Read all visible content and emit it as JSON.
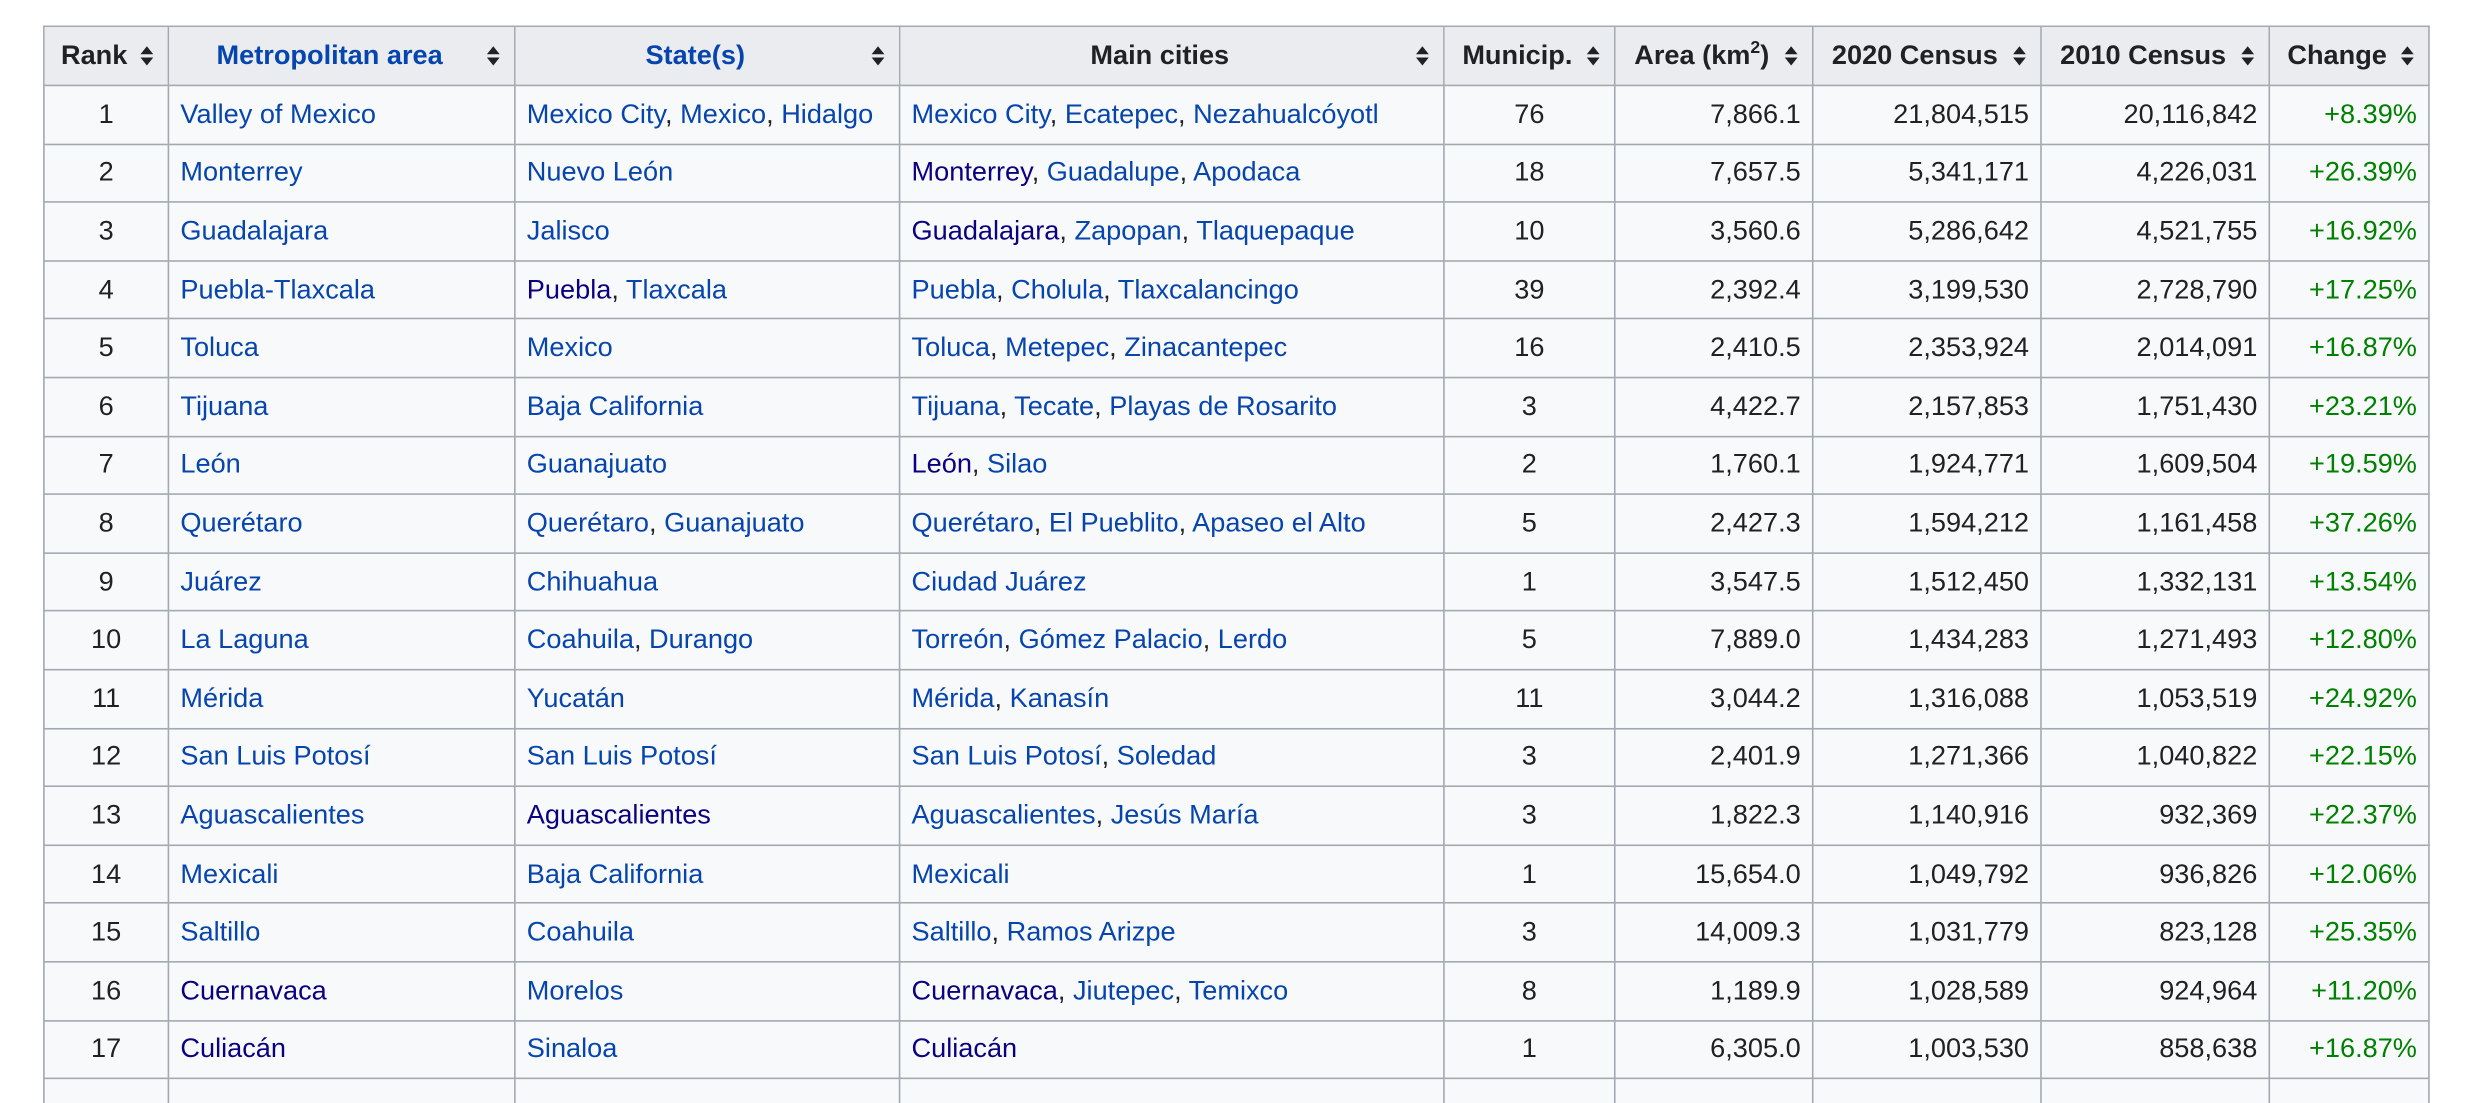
{
  "colors": {
    "link": "#0645ad",
    "link_visited": "#0b0080",
    "positive_change": "#008000",
    "header_bg": "#eaecf0",
    "cell_bg": "#f8f9fa",
    "border": "#a2a9b1"
  },
  "icons": {
    "sort": "sort-updown-icon"
  },
  "table": {
    "headers": {
      "rank": "Rank",
      "metro": "Metropolitan area",
      "states": "State(s)",
      "cities": "Main cities",
      "municip": "Municip.",
      "area": "Area (km",
      "area_sup": "2",
      "area_end": ")",
      "census2020": "2020 Census",
      "census2010": "2010 Census",
      "change": "Change"
    },
    "rows": [
      {
        "rank": "1",
        "metro": "Valley of Mexico",
        "metro_visited": false,
        "states": [
          {
            "t": "Mexico City",
            "v": false
          },
          {
            "t": "Mexico",
            "v": false
          },
          {
            "t": "Hidalgo",
            "v": false
          }
        ],
        "cities": [
          {
            "t": "Mexico City",
            "v": false
          },
          {
            "t": "Ecatepec",
            "v": false
          },
          {
            "t": "Nezahualcóyotl",
            "v": false
          }
        ],
        "municip": "76",
        "area": "7,866.1",
        "c2020": "21,804,515",
        "c2010": "20,116,842",
        "change": "+8.39%"
      },
      {
        "rank": "2",
        "metro": "Monterrey",
        "metro_visited": false,
        "states": [
          {
            "t": "Nuevo León",
            "v": false
          }
        ],
        "cities": [
          {
            "t": "Monterrey",
            "v": true
          },
          {
            "t": "Guadalupe",
            "v": false
          },
          {
            "t": "Apodaca",
            "v": false
          }
        ],
        "municip": "18",
        "area": "7,657.5",
        "c2020": "5,341,171",
        "c2010": "4,226,031",
        "change": "+26.39%"
      },
      {
        "rank": "3",
        "metro": "Guadalajara",
        "metro_visited": false,
        "states": [
          {
            "t": "Jalisco",
            "v": false
          }
        ],
        "cities": [
          {
            "t": "Guadalajara",
            "v": true
          },
          {
            "t": "Zapopan",
            "v": false
          },
          {
            "t": "Tlaquepaque",
            "v": false
          }
        ],
        "municip": "10",
        "area": "3,560.6",
        "c2020": "5,286,642",
        "c2010": "4,521,755",
        "change": "+16.92%"
      },
      {
        "rank": "4",
        "metro": "Puebla-Tlaxcala",
        "metro_visited": false,
        "states": [
          {
            "t": "Puebla",
            "v": true
          },
          {
            "t": "Tlaxcala",
            "v": false
          }
        ],
        "cities": [
          {
            "t": "Puebla",
            "v": false
          },
          {
            "t": "Cholula",
            "v": false
          },
          {
            "t": "Tlaxcalancingo",
            "v": false
          }
        ],
        "municip": "39",
        "area": "2,392.4",
        "c2020": "3,199,530",
        "c2010": "2,728,790",
        "change": "+17.25%"
      },
      {
        "rank": "5",
        "metro": "Toluca",
        "metro_visited": false,
        "states": [
          {
            "t": "Mexico",
            "v": false
          }
        ],
        "cities": [
          {
            "t": "Toluca",
            "v": false
          },
          {
            "t": "Metepec",
            "v": false
          },
          {
            "t": "Zinacantepec",
            "v": false
          }
        ],
        "municip": "16",
        "area": "2,410.5",
        "c2020": "2,353,924",
        "c2010": "2,014,091",
        "change": "+16.87%"
      },
      {
        "rank": "6",
        "metro": "Tijuana",
        "metro_visited": false,
        "states": [
          {
            "t": "Baja California",
            "v": false
          }
        ],
        "cities": [
          {
            "t": "Tijuana",
            "v": false
          },
          {
            "t": "Tecate",
            "v": false
          },
          {
            "t": "Playas de Rosarito",
            "v": false
          }
        ],
        "municip": "3",
        "area": "4,422.7",
        "c2020": "2,157,853",
        "c2010": "1,751,430",
        "change": "+23.21%"
      },
      {
        "rank": "7",
        "metro": "León",
        "metro_visited": false,
        "states": [
          {
            "t": "Guanajuato",
            "v": false
          }
        ],
        "cities": [
          {
            "t": "León",
            "v": true
          },
          {
            "t": "Silao",
            "v": false
          }
        ],
        "municip": "2",
        "area": "1,760.1",
        "c2020": "1,924,771",
        "c2010": "1,609,504",
        "change": "+19.59%"
      },
      {
        "rank": "8",
        "metro": "Querétaro",
        "metro_visited": false,
        "states": [
          {
            "t": "Querétaro",
            "v": false
          },
          {
            "t": "Guanajuato",
            "v": false
          }
        ],
        "cities": [
          {
            "t": "Querétaro",
            "v": false
          },
          {
            "t": "El Pueblito",
            "v": false
          },
          {
            "t": "Apaseo el Alto",
            "v": false
          }
        ],
        "municip": "5",
        "area": "2,427.3",
        "c2020": "1,594,212",
        "c2010": "1,161,458",
        "change": "+37.26%"
      },
      {
        "rank": "9",
        "metro": "Juárez",
        "metro_visited": false,
        "states": [
          {
            "t": "Chihuahua",
            "v": false
          }
        ],
        "cities": [
          {
            "t": "Ciudad Juárez",
            "v": false
          }
        ],
        "municip": "1",
        "area": "3,547.5",
        "c2020": "1,512,450",
        "c2010": "1,332,131",
        "change": "+13.54%"
      },
      {
        "rank": "10",
        "metro": "La Laguna",
        "metro_visited": false,
        "states": [
          {
            "t": "Coahuila",
            "v": false
          },
          {
            "t": "Durango",
            "v": false
          }
        ],
        "cities": [
          {
            "t": "Torreón",
            "v": false
          },
          {
            "t": "Gómez Palacio",
            "v": false
          },
          {
            "t": "Lerdo",
            "v": false
          }
        ],
        "municip": "5",
        "area": "7,889.0",
        "c2020": "1,434,283",
        "c2010": "1,271,493",
        "change": "+12.80%"
      },
      {
        "rank": "11",
        "metro": "Mérida",
        "metro_visited": false,
        "states": [
          {
            "t": "Yucatán",
            "v": false
          }
        ],
        "cities": [
          {
            "t": "Mérida",
            "v": false
          },
          {
            "t": "Kanasín",
            "v": false
          }
        ],
        "municip": "11",
        "area": "3,044.2",
        "c2020": "1,316,088",
        "c2010": "1,053,519",
        "change": "+24.92%"
      },
      {
        "rank": "12",
        "metro": "San Luis Potosí",
        "metro_visited": false,
        "states": [
          {
            "t": "San Luis Potosí",
            "v": false
          }
        ],
        "cities": [
          {
            "t": "San Luis Potosí",
            "v": false
          },
          {
            "t": "Soledad",
            "v": false
          }
        ],
        "municip": "3",
        "area": "2,401.9",
        "c2020": "1,271,366",
        "c2010": "1,040,822",
        "change": "+22.15%"
      },
      {
        "rank": "13",
        "metro": "Aguascalientes",
        "metro_visited": false,
        "states": [
          {
            "t": "Aguascalientes",
            "v": true
          }
        ],
        "cities": [
          {
            "t": "Aguascalientes",
            "v": false
          },
          {
            "t": "Jesús María",
            "v": false
          }
        ],
        "municip": "3",
        "area": "1,822.3",
        "c2020": "1,140,916",
        "c2010": "932,369",
        "change": "+22.37%"
      },
      {
        "rank": "14",
        "metro": "Mexicali",
        "metro_visited": false,
        "states": [
          {
            "t": "Baja California",
            "v": false
          }
        ],
        "cities": [
          {
            "t": "Mexicali",
            "v": false
          }
        ],
        "municip": "1",
        "area": "15,654.0",
        "c2020": "1,049,792",
        "c2010": "936,826",
        "change": "+12.06%"
      },
      {
        "rank": "15",
        "metro": "Saltillo",
        "metro_visited": false,
        "states": [
          {
            "t": "Coahuila",
            "v": false
          }
        ],
        "cities": [
          {
            "t": "Saltillo",
            "v": false
          },
          {
            "t": "Ramos Arizpe",
            "v": false
          }
        ],
        "municip": "3",
        "area": "14,009.3",
        "c2020": "1,031,779",
        "c2010": "823,128",
        "change": "+25.35%"
      },
      {
        "rank": "16",
        "metro": "Cuernavaca",
        "metro_visited": true,
        "states": [
          {
            "t": "Morelos",
            "v": false
          }
        ],
        "cities": [
          {
            "t": "Cuernavaca",
            "v": true
          },
          {
            "t": "Jiutepec",
            "v": false
          },
          {
            "t": "Temixco",
            "v": false
          }
        ],
        "municip": "8",
        "area": "1,189.9",
        "c2020": "1,028,589",
        "c2010": "924,964",
        "change": "+11.20%"
      },
      {
        "rank": "17",
        "metro": "Culiacán",
        "metro_visited": true,
        "states": [
          {
            "t": "Sinaloa",
            "v": false
          }
        ],
        "cities": [
          {
            "t": "Culiacán",
            "v": true
          }
        ],
        "municip": "1",
        "area": "6,305.0",
        "c2020": "1,003,530",
        "c2010": "858,638",
        "change": "+16.87%"
      }
    ]
  }
}
